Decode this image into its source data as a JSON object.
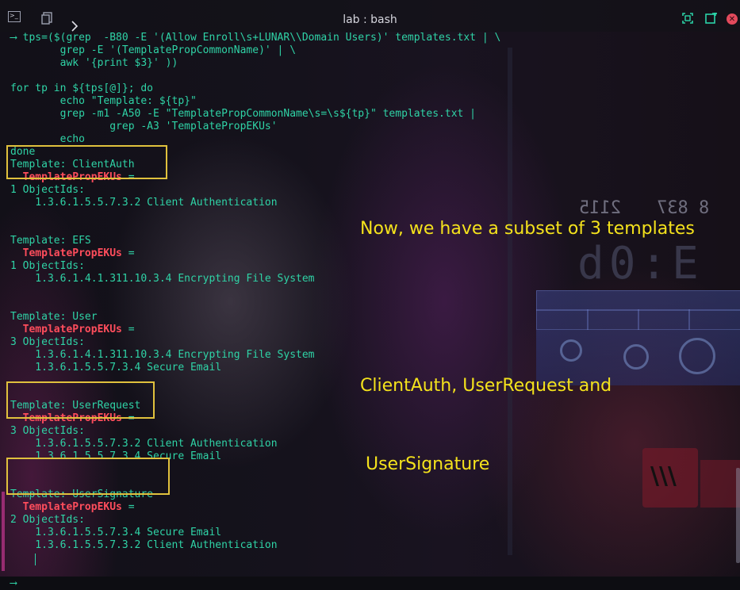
{
  "window": {
    "title": "lab : bash"
  },
  "terminal": {
    "lines": [
      {
        "segments": [
          {
            "text": "⟶ tps=($(grep  -B80 -E '(Allow Enroll\\s+LUNAR\\\\Domain Users)' templates.txt | \\"
          }
        ]
      },
      {
        "segments": [
          {
            "text": "        grep -E '(TemplatePropCommonName)' | \\"
          }
        ]
      },
      {
        "segments": [
          {
            "text": "        awk '{print $3}' ))"
          }
        ]
      },
      {
        "segments": [
          {
            "text": ""
          }
        ]
      },
      {
        "segments": [
          {
            "text": "for tp in ${tps[@]}; do"
          }
        ]
      },
      {
        "segments": [
          {
            "text": "        echo \"Template: ${tp}\""
          }
        ]
      },
      {
        "segments": [
          {
            "text": "        grep -m1 -A50 -E \"TemplatePropCommonName\\s=\\s${tp}\" templates.txt |"
          }
        ]
      },
      {
        "segments": [
          {
            "text": "                grep -A3 'TemplatePropEKUs'"
          }
        ]
      },
      {
        "segments": [
          {
            "text": "        echo"
          }
        ]
      },
      {
        "segments": [
          {
            "text": "done"
          }
        ]
      },
      {
        "segments": [
          {
            "text": "Template: ClientAuth"
          }
        ]
      },
      {
        "segments": [
          {
            "text": "  "
          },
          {
            "text": "TemplatePropEKUs",
            "hl": true
          },
          {
            "text": " ="
          }
        ]
      },
      {
        "segments": [
          {
            "text": "1 ObjectIds:"
          }
        ]
      },
      {
        "segments": [
          {
            "text": "    1.3.6.1.5.5.7.3.2 Client Authentication"
          }
        ]
      },
      {
        "segments": [
          {
            "text": ""
          }
        ]
      },
      {
        "segments": [
          {
            "text": ""
          }
        ]
      },
      {
        "segments": [
          {
            "text": "Template: EFS"
          }
        ]
      },
      {
        "segments": [
          {
            "text": "  "
          },
          {
            "text": "TemplatePropEKUs",
            "hl": true
          },
          {
            "text": " ="
          }
        ]
      },
      {
        "segments": [
          {
            "text": "1 ObjectIds:"
          }
        ]
      },
      {
        "segments": [
          {
            "text": "    1.3.6.1.4.1.311.10.3.4 Encrypting File System"
          }
        ]
      },
      {
        "segments": [
          {
            "text": ""
          }
        ]
      },
      {
        "segments": [
          {
            "text": ""
          }
        ]
      },
      {
        "segments": [
          {
            "text": "Template: User"
          }
        ]
      },
      {
        "segments": [
          {
            "text": "  "
          },
          {
            "text": "TemplatePropEKUs",
            "hl": true
          },
          {
            "text": " ="
          }
        ]
      },
      {
        "segments": [
          {
            "text": "3 ObjectIds:"
          }
        ]
      },
      {
        "segments": [
          {
            "text": "    1.3.6.1.4.1.311.10.3.4 Encrypting File System"
          }
        ]
      },
      {
        "segments": [
          {
            "text": "    1.3.6.1.5.5.7.3.4 Secure Email"
          }
        ]
      },
      {
        "segments": [
          {
            "text": ""
          }
        ]
      },
      {
        "segments": [
          {
            "text": ""
          }
        ]
      },
      {
        "segments": [
          {
            "text": "Template: UserRequest"
          }
        ]
      },
      {
        "segments": [
          {
            "text": "  "
          },
          {
            "text": "TemplatePropEKUs",
            "hl": true
          },
          {
            "text": " ="
          }
        ]
      },
      {
        "segments": [
          {
            "text": "3 ObjectIds:"
          }
        ]
      },
      {
        "segments": [
          {
            "text": "    1.3.6.1.5.5.7.3.2 Client Authentication"
          }
        ]
      },
      {
        "segments": [
          {
            "text": "    1.3.6.1.5.5.7.3.4 Secure Email"
          }
        ]
      },
      {
        "segments": [
          {
            "text": ""
          }
        ]
      },
      {
        "segments": [
          {
            "text": ""
          }
        ]
      },
      {
        "segments": [
          {
            "text": "Template: UserSignature"
          }
        ]
      },
      {
        "segments": [
          {
            "text": "  "
          },
          {
            "text": "TemplatePropEKUs",
            "hl": true
          },
          {
            "text": " ="
          }
        ]
      },
      {
        "segments": [
          {
            "text": "2 ObjectIds:"
          }
        ]
      },
      {
        "segments": [
          {
            "text": "    1.3.6.1.5.5.7.3.4 Secure Email"
          }
        ]
      },
      {
        "segments": [
          {
            "text": "    1.3.6.1.5.5.7.3.2 Client Authentication"
          }
        ]
      },
      {
        "segments": [
          {
            "text": ""
          }
        ]
      },
      {
        "segments": [
          {
            "text": ""
          }
        ]
      },
      {
        "segments": [
          {
            "text": "⟶ "
          }
        ]
      }
    ]
  },
  "annotation": {
    "line1": "Now, we have a subset of 3 templates",
    "line2": "ClientAuth, UserRequest and",
    "line3": " UserSignature"
  },
  "wallpaper": {
    "clock_large": "d0:E",
    "clock_small_left": "2115",
    "clock_small_right": "8 837",
    "sign_text": "\\\\\\"
  },
  "colors": {
    "terminal_text": "#2fd3a6",
    "highlight": "#ff4d5c",
    "annotation": "#f4e21c",
    "box": "#e0c13d"
  },
  "icons": {
    "terminal": "terminal-icon",
    "copy": "copy-icon",
    "chevron": "chevron-right-icon",
    "maximize": "maximize-icon",
    "new_window": "new-window-icon",
    "close": "close-icon"
  }
}
